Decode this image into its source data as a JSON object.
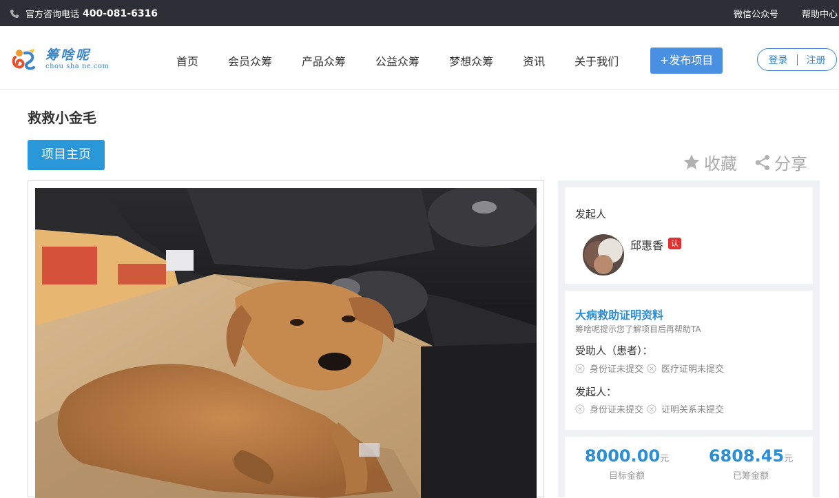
{
  "topbar": {
    "hotline_label": "官方咨询电话",
    "hotline_number": "400-081-6316",
    "links": [
      "微信公众号",
      "帮助中心"
    ]
  },
  "logo": {
    "name": "筹啥呢",
    "domain_text": "chou sha ne.com"
  },
  "nav": {
    "items": [
      "首页",
      "会员众筹",
      "产品众筹",
      "公益众筹",
      "梦想众筹",
      "资讯",
      "关于我们"
    ],
    "publish_label": "+发布项目",
    "login_label": "登录",
    "register_label": "注册"
  },
  "project": {
    "title": "救救小金毛",
    "home_button": "项目主页",
    "favorite_label": "收藏",
    "share_label": "分享"
  },
  "initiator": {
    "section_label": "发起人",
    "name": "邱惠香",
    "badge": "认"
  },
  "proof": {
    "title": "大病救助证明资料",
    "tip": "筹啥呢提示您了解项目后再帮助TA",
    "recipient_label": "受助人（患者）：",
    "recipient_items": [
      "身份证未提交",
      "医疗证明未提交"
    ],
    "initiator_label": "发起人：",
    "initiator_items": [
      "身份证未提交",
      "证明关系未提交"
    ]
  },
  "funding": {
    "target_value": "8000.00",
    "target_unit": "元",
    "target_label": "目标金额",
    "raised_value": "6808.45",
    "raised_unit": "元",
    "raised_label": "已筹金额"
  },
  "colors": {
    "accent": "#2a97d8",
    "publish_button": "#4a90e2",
    "topbar": "#2c2f36",
    "badge": "#e0302f"
  }
}
